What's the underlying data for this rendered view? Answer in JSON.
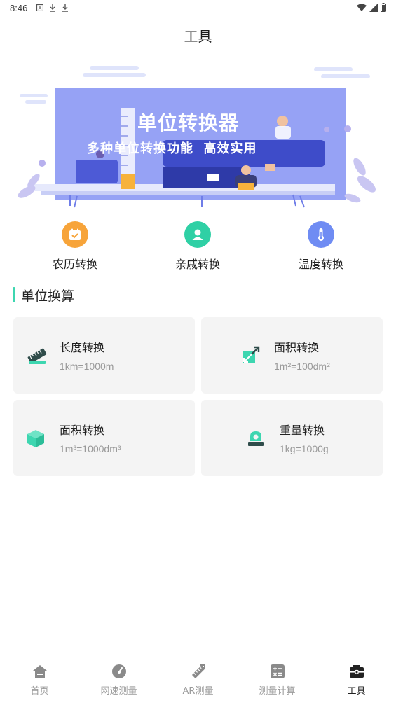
{
  "status_bar": {
    "time": "8:46",
    "left_icons": [
      "a-icon",
      "download-icon",
      "download-icon"
    ],
    "right_icons": [
      "wifi-icon",
      "signal-icon",
      "battery-icon"
    ]
  },
  "page": {
    "title": "工具"
  },
  "banner": {
    "title": "单位转换器",
    "subtitle": "多种单位转换功能  高效实用"
  },
  "quick_tools": [
    {
      "label": "农历转换",
      "icon": "calendar-icon",
      "color": "#f7a43a"
    },
    {
      "label": "亲戚转换",
      "icon": "person-icon",
      "color": "#2fd0a5"
    },
    {
      "label": "温度转换",
      "icon": "thermometer-icon",
      "color": "#6f8cf3"
    }
  ],
  "section": {
    "title": "单位换算",
    "accent": "#3dd6b0"
  },
  "cards": [
    {
      "title": "长度转换",
      "subtitle": "1km=1000m",
      "icon": "ruler-icon"
    },
    {
      "title": "面积转换",
      "subtitle": "1m²=100dm²",
      "icon": "area-icon"
    },
    {
      "title": "面积转换",
      "subtitle": "1m³=1000dm³",
      "icon": "cube-icon"
    },
    {
      "title": "重量转换",
      "subtitle": "1kg=1000g",
      "icon": "weight-icon"
    }
  ],
  "bottom_nav": [
    {
      "label": "首页",
      "icon": "home-icon",
      "active": false
    },
    {
      "label": "网速测量",
      "icon": "speedometer-icon",
      "active": false
    },
    {
      "label": "AR测量",
      "icon": "ar-ruler-icon",
      "active": false
    },
    {
      "label": "测量计算",
      "icon": "calculator-icon",
      "active": false
    },
    {
      "label": "工具",
      "icon": "toolbox-icon",
      "active": true
    }
  ]
}
